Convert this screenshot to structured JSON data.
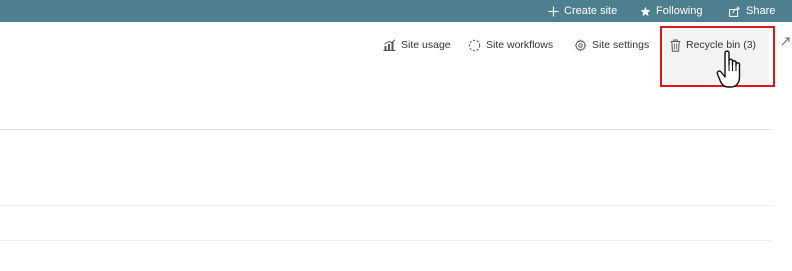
{
  "topbar": {
    "create_site": "Create site",
    "following": "Following",
    "share": "Share"
  },
  "commandbar": {
    "site_usage": "Site usage",
    "site_workflows": "Site workflows",
    "site_settings": "Site settings",
    "recycle_bin": "Recycle bin (3)"
  },
  "colors": {
    "topbar_bg": "#4e7f8f",
    "highlight": "#e0161b"
  }
}
